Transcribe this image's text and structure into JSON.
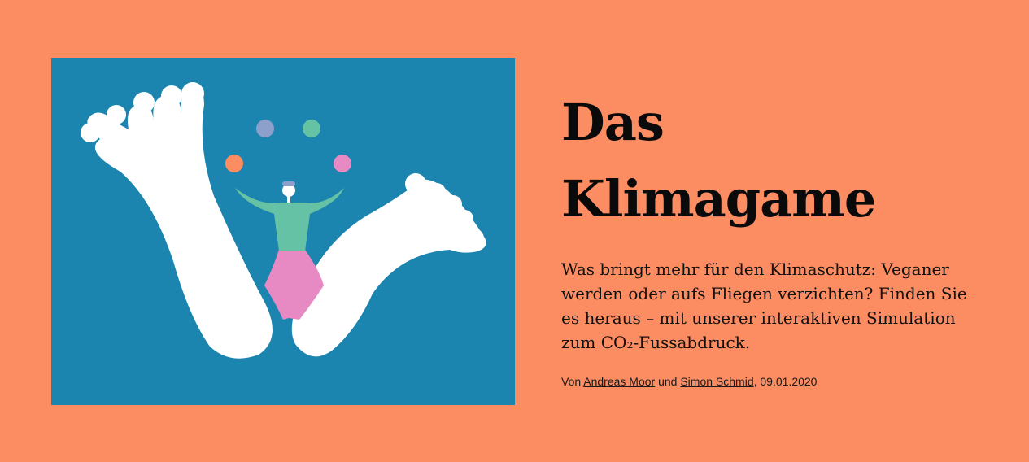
{
  "article": {
    "title_line1": "Das",
    "title_line2": "Klimagame",
    "lead": "Was bringt mehr für den Klimaschutz: Veganer werden oder aufs Fliegen verzichten? Finden Sie es heraus – mit unserer interaktiven Simulation zum CO₂-Fussabdruck.",
    "byline": {
      "prefix": "Von",
      "author1": "Andreas Moor",
      "conjunction": "und",
      "author2": "Simon Schmid",
      "date_sep": ",",
      "date": "09.01.2020"
    }
  },
  "colors": {
    "background": "#FC8D62",
    "image_bg": "#1B84AF",
    "foot": "#FFFFFF",
    "ball_purple": "#8DA0CB",
    "ball_green": "#66C2A5",
    "ball_orange": "#FC8D62",
    "ball_pink": "#E78AC3"
  },
  "illustration": {
    "icon": "juggler-with-giant-feet-illustration"
  }
}
